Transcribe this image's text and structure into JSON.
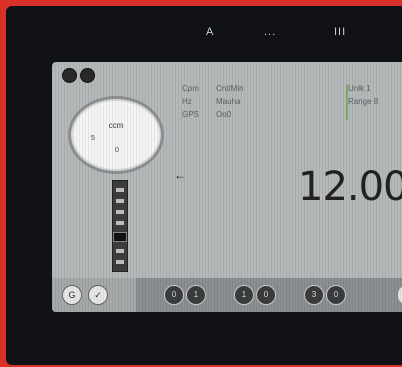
{
  "topbar": {
    "icons": [
      "A",
      "...",
      "III"
    ]
  },
  "window": {
    "traffic_lights": [
      "close",
      "minimize"
    ]
  },
  "dial": {
    "label": "ccm",
    "ticks": [
      "5",
      "0"
    ]
  },
  "big_value": "12.00",
  "info_panel": {
    "rows": [
      {
        "k": "Cpm",
        "v": "Cnt/Min"
      },
      {
        "k": "Hz",
        "v": "Mauha"
      },
      {
        "k": "GPS",
        "v": "Oo0"
      }
    ]
  },
  "info_panel_right": {
    "rows": [
      "Unlk 1",
      "Range 8"
    ]
  },
  "bottom": {
    "left_buttons": [
      "G",
      "✓"
    ],
    "groups": [
      [
        "0",
        "1"
      ],
      [
        "1",
        "0"
      ],
      [
        "3",
        "0"
      ]
    ]
  },
  "colors": {
    "frame": "#d9302a",
    "panel": "#b6b9ba",
    "bar": "#8c8f91",
    "accent_green": "#6fae5a"
  }
}
